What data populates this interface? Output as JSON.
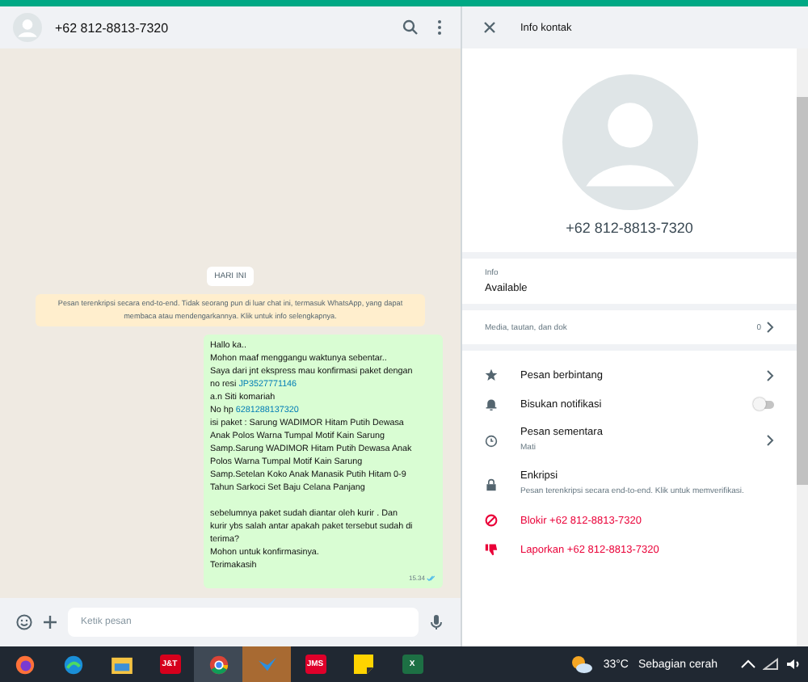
{
  "chat": {
    "contact": "+62 812-8813-7320",
    "date_chip": "HARI INI",
    "encryption_notice": "Pesan terenkripsi secara end-to-end. Tidak seorang pun di luar chat ini, termasuk WhatsApp, yang dapat membaca atau mendengarkannya. Klik untuk info selengkapnya.",
    "message": {
      "paragraphs": [
        [
          {
            "text": "Hallo ka.."
          },
          {
            "text": "Mohon maaf menggangu waktunya sebentar.."
          },
          {
            "text": "Saya dari jnt ekspress mau konfirmasi paket dengan"
          },
          {
            "text": "no resi ",
            "link": "JP3527771146"
          },
          {
            "text": "a.n Siti komariah"
          },
          {
            "text": "No hp ",
            "link": "6281288137320"
          },
          {
            "text": "isi paket : Sarung WADIMOR Hitam Putih Dewasa"
          },
          {
            "text": "Anak Polos Warna Tumpal Motif Kain Sarung"
          },
          {
            "text": "Samp.Sarung WADIMOR Hitam Putih Dewasa Anak"
          },
          {
            "text": "Polos Warna Tumpal Motif Kain Sarung"
          },
          {
            "text": "Samp.Setelan Koko Anak Manasik Putih Hitam 0-9"
          },
          {
            "text": "Tahun Sarkoci Set Baju Celana Panjang"
          }
        ],
        [
          {
            "text": "sebelumnya paket sudah diantar oleh kurir . Dan"
          },
          {
            "text": "kurir ybs salah antar apakah paket tersebut sudah di"
          },
          {
            "text": "terima?"
          },
          {
            "text": "Mohon untuk konfirmasinya."
          },
          {
            "text": "Terimakasih"
          }
        ]
      ],
      "time": "15.34",
      "read": true
    },
    "compose_placeholder": "Ketik pesan"
  },
  "info": {
    "title": "Info kontak",
    "phone": "+62 812-8813-7320",
    "about_label": "Info",
    "about": "Available",
    "media_label": "Media, tautan, dan dok",
    "media_count": "0",
    "items": [
      {
        "kind": "link",
        "label": "Pesan berbintang"
      },
      {
        "kind": "toggle",
        "label": "Bisukan notifikasi",
        "on": false
      },
      {
        "kind": "link",
        "label": "Pesan sementara",
        "sub": "Mati"
      },
      {
        "kind": "plain",
        "label": "Enkripsi",
        "sub": "Pesan terenkripsi secara end-to-end. Klik untuk memverifikasi."
      }
    ],
    "actions": [
      {
        "label": "Blokir +62 812-8813-7320"
      },
      {
        "label": "Laporkan +62 812-8813-7320"
      }
    ]
  },
  "taskbar": {
    "apps": [
      {
        "kind": "firefox",
        "selected": false
      },
      {
        "kind": "edge",
        "selected": false
      },
      {
        "kind": "folder",
        "selected": false
      },
      {
        "kind": "jnt",
        "label": "J&T",
        "selected": false
      },
      {
        "kind": "chrome",
        "selected": true
      },
      {
        "kind": "bird",
        "selected": true
      },
      {
        "kind": "jms",
        "label": "JMS",
        "selected": false
      },
      {
        "kind": "notes",
        "selected": false
      },
      {
        "kind": "excel",
        "label": "X",
        "selected": false
      }
    ],
    "temperature": "33°C",
    "weather": "Sebagian cerah"
  }
}
